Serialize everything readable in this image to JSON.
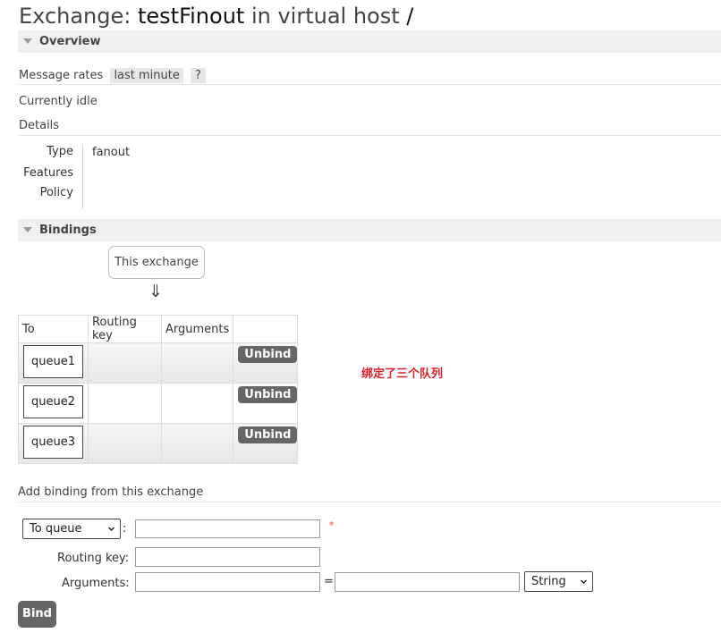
{
  "header": {
    "prefix": "Exchange: ",
    "name": "testFinout",
    "middle": " in virtual host ",
    "vhost": "/"
  },
  "overview": {
    "title": "Overview",
    "message_rates_label": "Message rates",
    "rate_period": "last minute",
    "help": "?",
    "status": "Currently idle",
    "details_title": "Details",
    "details": {
      "type_label": "Type",
      "type_value": "fanout",
      "features_label": "Features",
      "policy_label": "Policy"
    }
  },
  "bindings": {
    "title": "Bindings",
    "this_exchange": "This exchange",
    "arrow": "⇓",
    "columns": [
      "To",
      "Routing key",
      "Arguments",
      ""
    ],
    "rows": [
      {
        "to": "queue1",
        "routing_key": "",
        "arguments": "",
        "action": "Unbind"
      },
      {
        "to": "queue2",
        "routing_key": "",
        "arguments": "",
        "action": "Unbind"
      },
      {
        "to": "queue3",
        "routing_key": "",
        "arguments": "",
        "action": "Unbind"
      }
    ],
    "annotation": "绑定了三个队列"
  },
  "add_binding": {
    "title": "Add binding from this exchange",
    "destination_type": "To queue",
    "colon": ":",
    "required_mark": "*",
    "destination_value": "",
    "routing_key_label": "Routing key:",
    "routing_key_value": "",
    "arguments_label": "Arguments:",
    "equals": "=",
    "arg_key_value": "",
    "arg_value_value": "",
    "arg_type": "String",
    "bind_label": "Bind"
  }
}
